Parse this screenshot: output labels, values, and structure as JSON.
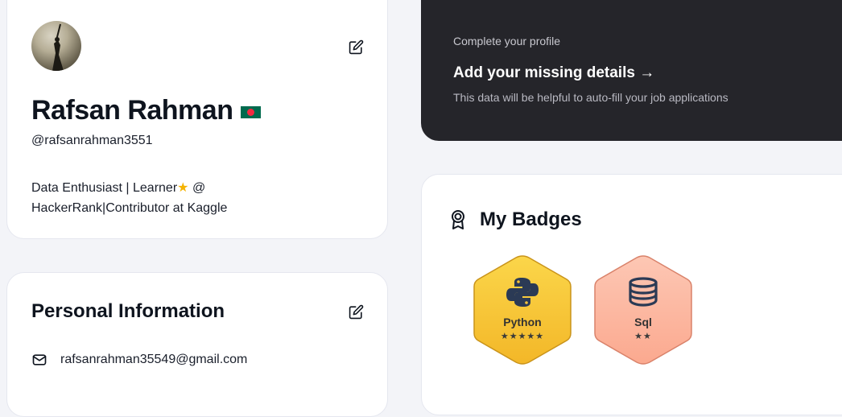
{
  "profile": {
    "name": "Rafsan Rahman",
    "handle": "@rafsanrahman3551",
    "bio_line1": "Data Enthusiast | Learner",
    "bio_line1_end": " @",
    "bio_line2": "HackerRank|Contributor at Kaggle",
    "flag_icon": "bangladesh-flag-icon"
  },
  "personal_info": {
    "title": "Personal Information",
    "email": "rafsanrahman35549@gmail.com"
  },
  "cta": {
    "kicker": "Complete your profile",
    "title": "Add your missing details →",
    "subtitle": "This data will be helpful to auto-fill your job applications"
  },
  "badges": {
    "title": "My Badges",
    "items": [
      {
        "name": "Python",
        "stars": "★★★★★",
        "star_count": 5,
        "icon": "python-icon",
        "color": "#f6c338"
      },
      {
        "name": "Sql",
        "stars": "★★",
        "star_count": 2,
        "icon": "database-icon",
        "color": "#fdb39e"
      }
    ]
  },
  "colors": {
    "background": "#f3f4f8",
    "dark_card": "#25252a",
    "text": "#0e141e"
  }
}
